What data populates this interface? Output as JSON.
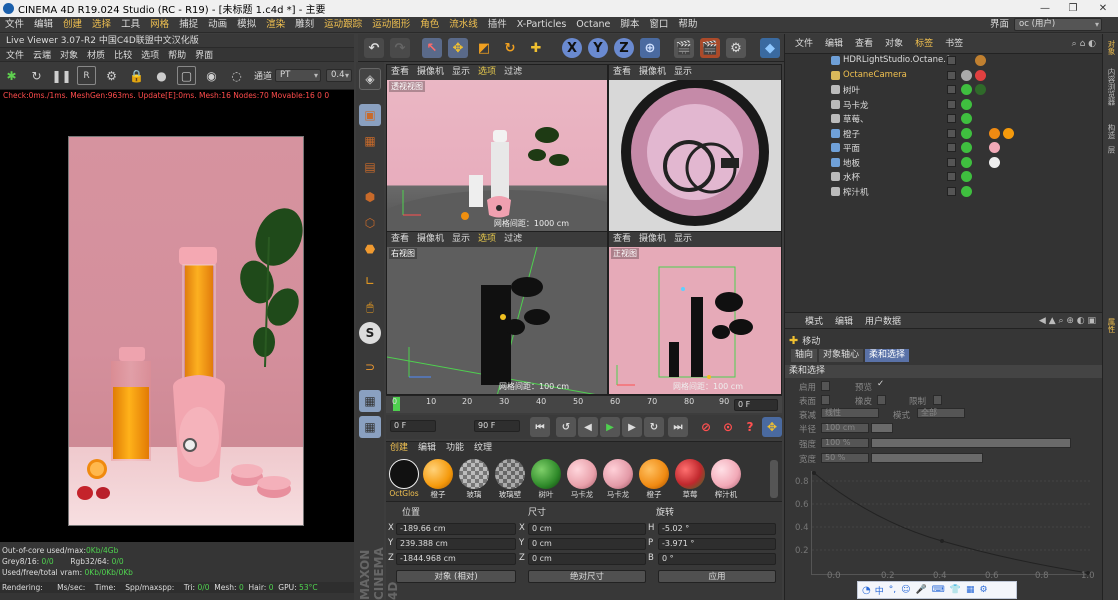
{
  "titlebar": {
    "title": "CINEMA 4D R19.024 Studio (RC - R19) - [未标题 1.c4d *] - 主要"
  },
  "menubar": {
    "items": [
      "文件",
      "编辑",
      "创建",
      "选择",
      "工具",
      "网格",
      "捕捉",
      "动画",
      "模拟",
      "渲染",
      "雕刻",
      "运动跟踪",
      "运动图形",
      "角色",
      "流水线",
      "插件",
      "X-Particles",
      "Octane",
      "脚本",
      "窗口",
      "帮助"
    ],
    "layout_label": "界面",
    "layout_value": "oc (用户)"
  },
  "live_viewer": {
    "title": "Live Viewer 3.07-R2 中国C4D联盟中文汉化版",
    "menu": [
      "文件",
      "云端",
      "对象",
      "材质",
      "比较",
      "选项",
      "帮助",
      "界面"
    ],
    "channel_label": "通道",
    "channel_value": "PT",
    "zoom_value": "0.4",
    "status": "Check:0ms./1ms. MeshGen:963ms. Update[E]:0ms. Mesh:16 Nodes:70 Movable:16  0  0",
    "info": {
      "outofcore_label": "Out-of-core used/max:",
      "outofcore_value": "0Kb/4Gb",
      "grey_label": "Grey8/16:",
      "grey_value": "0/0",
      "rgb_label": "Rgb32/64:",
      "rgb_value": "0/0",
      "vram_label": "Used/free/total vram:",
      "vram_value": "0Kb/0Kb/0Kb",
      "rendering_label": "Rendering:",
      "ms_label": "Ms/sec:",
      "time_label": "Time:",
      "spp_label": "Spp/maxspp:",
      "tri_label": "Tri:",
      "tri_value": "0/0",
      "mesh_label": "Mesh:",
      "mesh_value": "0",
      "hair_label": "Hair:",
      "hair_value": "0",
      "gpu_label": "GPU:",
      "gpu_value": "53°C"
    }
  },
  "viewports": {
    "menu": [
      "查看",
      "摄像机",
      "显示",
      "选项",
      "过滤"
    ],
    "menu_short": [
      "查看",
      "摄像机",
      "显示"
    ],
    "perspective_label": "透视视图",
    "perspective_grid": "网格间距：1000 cm",
    "right_label": "右视图",
    "right_grid": "网格间距：100 cm",
    "front_label": "正视图",
    "front_grid": "网格间距：100 cm"
  },
  "timeline": {
    "ticks": [
      "0",
      "10",
      "20",
      "30",
      "40",
      "50",
      "60",
      "70",
      "80",
      "90"
    ],
    "current": "0 F",
    "start": "0 F",
    "end": "90 F"
  },
  "material_manager": {
    "menu": [
      "创建",
      "编辑",
      "功能",
      "纹理"
    ],
    "materials": [
      {
        "name": "OctGlos",
        "color": "#111111"
      },
      {
        "name": "橙子",
        "color": "#f59a0c"
      },
      {
        "name": "玻璃",
        "color": "#9a9a9a"
      },
      {
        "name": "玻璃壁",
        "color": "#7f7f7f"
      },
      {
        "name": "树叶",
        "color": "#2f8a2a"
      },
      {
        "name": "马卡龙",
        "color": "#e9a1ab"
      },
      {
        "name": "马卡龙",
        "color": "#e39aa7"
      },
      {
        "name": "橙子",
        "color": "#f08a12"
      },
      {
        "name": "草莓",
        "color": "#c0282d"
      },
      {
        "name": "榨汁机",
        "color": "#f2a9b7"
      }
    ]
  },
  "coordinates": {
    "position_label": "位置",
    "size_label": "尺寸",
    "rotation_label": "旋转",
    "rows": [
      {
        "axis": "X",
        "pos": "-189.66 cm",
        "size": "0 cm",
        "rot_axis": "H",
        "rot": "-5.02 °"
      },
      {
        "axis": "Y",
        "pos": "239.388 cm",
        "size": "0 cm",
        "rot_axis": "P",
        "rot": "-3.971 °"
      },
      {
        "axis": "Z",
        "pos": "-1844.968 cm",
        "size": "0 cm",
        "rot_axis": "B",
        "rot": "0 °"
      }
    ],
    "mode_value": "对象 (相对)",
    "size_mode_value": "绝对尺寸",
    "apply_label": "应用"
  },
  "object_manager": {
    "menu": [
      "文件",
      "编辑",
      "查看",
      "对象",
      "标签",
      "书签"
    ],
    "objects": [
      {
        "name": "HDRLightStudio.Octane.1",
        "icon": "#6fa0d8",
        "hl": false
      },
      {
        "name": "OctaneCamera",
        "icon": "#d9b85a",
        "hl": true
      },
      {
        "name": "树叶",
        "icon": "#bbbbbb",
        "hl": false
      },
      {
        "name": "马卡龙",
        "icon": "#bbbbbb",
        "hl": false
      },
      {
        "name": "草莓、",
        "icon": "#bbbbbb",
        "hl": false
      },
      {
        "name": "橙子",
        "icon": "#6fa0d8",
        "hl": false
      },
      {
        "name": "平面",
        "icon": "#6fa0d8",
        "hl": false
      },
      {
        "name": "地板",
        "icon": "#6fa0d8",
        "hl": false
      },
      {
        "name": "水杯",
        "icon": "#bbbbbb",
        "hl": false
      },
      {
        "name": "榨汁机",
        "icon": "#bbbbbb",
        "hl": false
      }
    ]
  },
  "attribute_manager": {
    "menu": [
      "模式",
      "编辑",
      "用户数据"
    ],
    "tool_name": "移动",
    "tabs": [
      "轴向",
      "对象轴心",
      "柔和选择"
    ],
    "section": "柔和选择",
    "fields": {
      "enable_label": "启用",
      "preview_label": "预览",
      "surface_label": "表面",
      "rubber_label": "橡皮",
      "limit_label": "限制",
      "falloff_label": "衰减",
      "falloff_value": "线性",
      "mode_label": "模式",
      "mode_value": "全部",
      "radius_label": "半径",
      "radius_value": "100 cm",
      "strength_label": "强度",
      "strength_value": "100 %",
      "width_label": "宽度",
      "width_value": "50 %"
    },
    "graph_y": [
      "0.8",
      "0.6",
      "0.4",
      "0.2"
    ],
    "graph_x": [
      "0.0",
      "0.2",
      "0.4",
      "0.6",
      "0.8",
      "1.0"
    ]
  },
  "side_tabs": [
    "对象",
    "内容浏览器",
    "构造",
    "层",
    "属性"
  ]
}
